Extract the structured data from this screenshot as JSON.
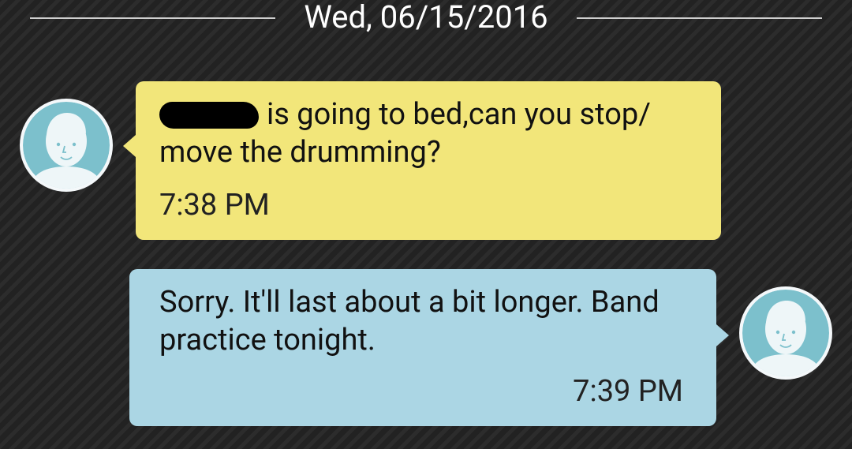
{
  "conversation": {
    "date": "Wed, 06/15/2016",
    "messages": [
      {
        "direction": "incoming",
        "text": "is going to bed,can you stop/ move the drumming?",
        "time": "7:38 PM",
        "bubble_color": "#f2e67a",
        "avatar_icon": "default-contact-icon"
      },
      {
        "direction": "outgoing",
        "text": "Sorry. It'll last about a bit longer. Band practice tonight.",
        "time": "7:39 PM",
        "bubble_color": "#abd6e4",
        "avatar_icon": "default-contact-icon"
      }
    ]
  },
  "colors": {
    "background": "#262626",
    "avatar_face": "#7cc0cc",
    "divider": "#cfcfcf"
  }
}
